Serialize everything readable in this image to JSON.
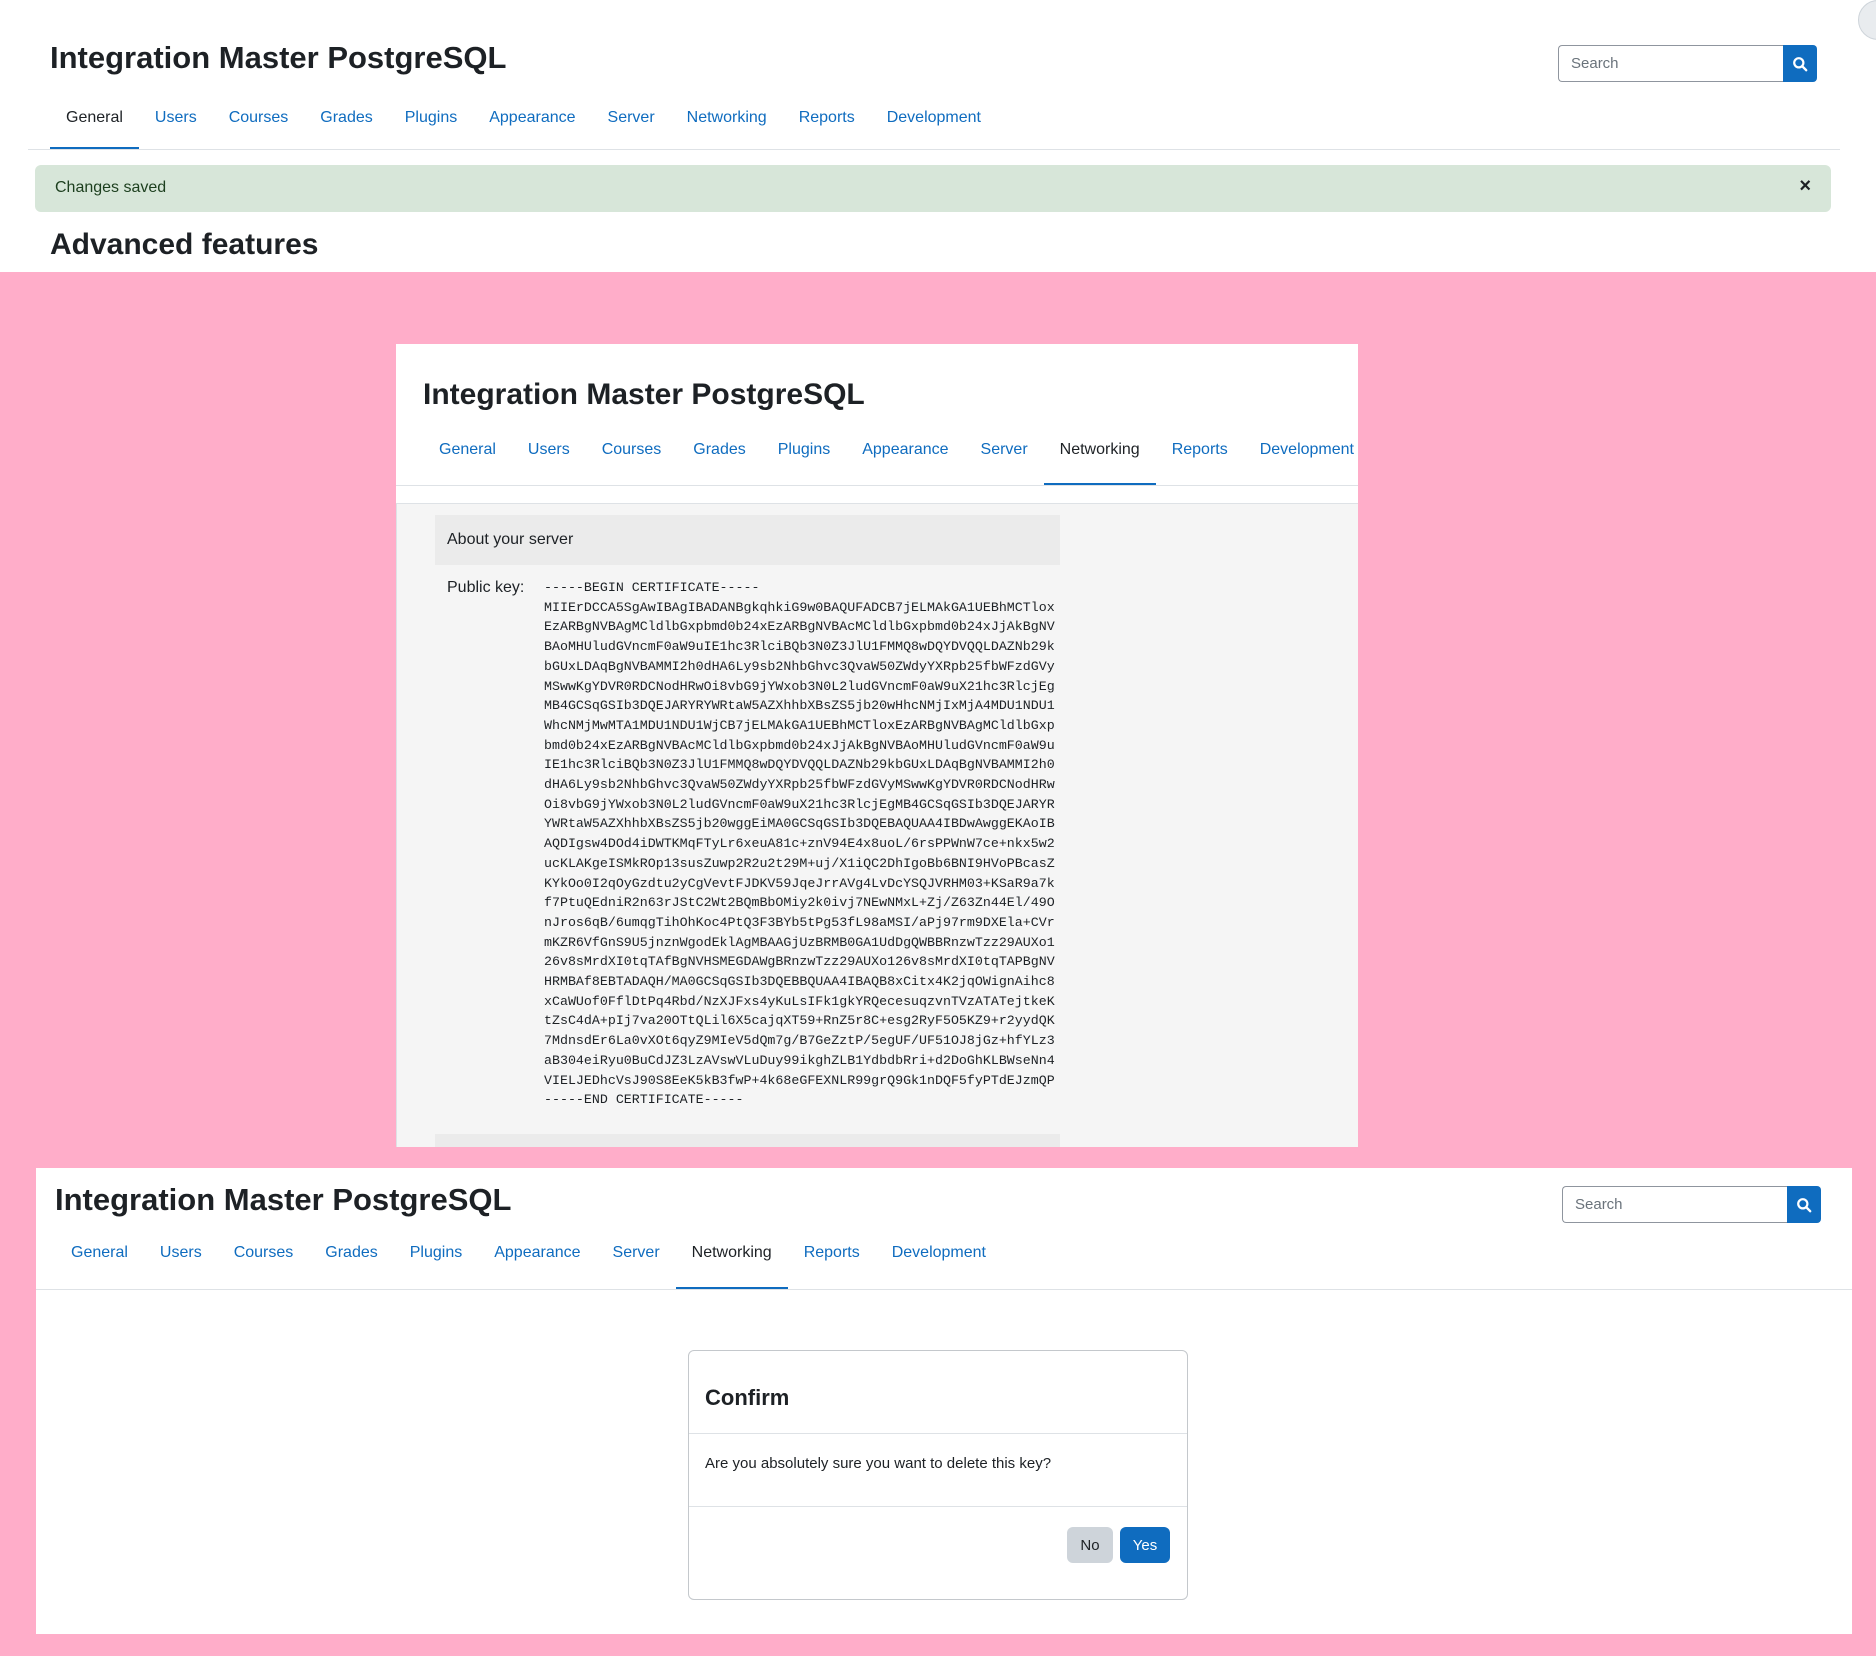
{
  "site_title": "Integration Master PostgreSQL",
  "search": {
    "placeholder": "Search"
  },
  "nav_tabs": [
    "General",
    "Users",
    "Courses",
    "Grades",
    "Plugins",
    "Appearance",
    "Server",
    "Networking",
    "Reports",
    "Development"
  ],
  "panel_general": {
    "active_tab": "General",
    "alert_message": "Changes saved",
    "alert_close": "×",
    "page_heading": "Advanced features"
  },
  "panel_networking": {
    "active_tab": "Networking",
    "section_heading": "About your server",
    "public_key_label": "Public key:",
    "public_key_lines": [
      "-----BEGIN CERTIFICATE-----",
      "MIIErDCCA5SgAwIBAgIBADANBgkqhkiG9w0BAQUFADCB7jELMAkGA1UEBhMCTlox",
      "EzARBgNVBAgMCldlbGxpbmd0b24xEzARBgNVBAcMCldlbGxpbmd0b24xJjAkBgNV",
      "BAoMHUludGVncmF0aW9uIE1hc3RlciBQb3N0Z3JlU1FMMQ8wDQYDVQQLDAZNb29k",
      "bGUxLDAqBgNVBAMMI2h0dHA6Ly9sb2NhbGhvc3QvaW50ZWdyYXRpb25fbWFzdGVy",
      "MSwwKgYDVR0RDCNodHRwOi8vbG9jYWxob3N0L2ludGVncmF0aW9uX21hc3RlcjEg",
      "MB4GCSqGSIb3DQEJARYRYWRtaW5AZXhhbXBsZS5jb20wHhcNMjIxMjA4MDU1NDU1",
      "WhcNMjMwMTA1MDU1NDU1WjCB7jELMAkGA1UEBhMCTloxEzARBgNVBAgMCldlbGxp",
      "bmd0b24xEzARBgNVBAcMCldlbGxpbmd0b24xJjAkBgNVBAoMHUludGVncmF0aW9u",
      "IE1hc3RlciBQb3N0Z3JlU1FMMQ8wDQYDVQQLDAZNb29kbGUxLDAqBgNVBAMMI2h0",
      "dHA6Ly9sb2NhbGhvc3QvaW50ZWdyYXRpb25fbWFzdGVyMSwwKgYDVR0RDCNodHRw",
      "Oi8vbG9jYWxob3N0L2ludGVncmF0aW9uX21hc3RlcjEgMB4GCSqGSIb3DQEJARYR",
      "YWRtaW5AZXhhbXBsZS5jb20wggEiMA0GCSqGSIb3DQEBAQUAA4IBDwAwggEKAoIB",
      "AQDIgsw4DOd4iDWTKMqFTyLr6xeuA81c+znV94E4x8uoL/6rsPPWnW7ce+nkx5w2",
      "ucKLAKgeISMkROp13susZuwp2R2u2t29M+uj/X1iQC2DhIgoBb6BNI9HVoPBcasZ",
      "KYkOo0I2qOyGzdtu2yCgVevtFJDKV59JqeJrrAVg4LvDcYSQJVRHM03+KSaR9a7k",
      "f7PtuQEdniR2n63rJStC2Wt2BQmBbOMiy2k0ivj7NEwNMxL+Zj/Z63Zn44El/49O",
      "nJros6qB/6umqgTihOhKoc4PtQ3F3BYb5tPg53fL98aMSI/aPj97rm9DXEla+CVr",
      "mKZR6VfGnS9U5jnznWgodEklAgMBAAGjUzBRMB0GA1UdDgQWBBRnzwTzz29AUXo1",
      "26v8sMrdXI0tqTAfBgNVHSMEGDAWgBRnzwTzz29AUXo126v8sMrdXI0tqTAPBgNV",
      "HRMBAf8EBTADAQH/MA0GCSqGSIb3DQEBBQUAA4IBAQB8xCitx4K2jqOWignAihc8",
      "xCaWUof0FflDtPq4Rbd/NzXJFxs4yKuLsIFk1gkYRQecesuqzvnTVzATATejtkeK",
      "tZsC4dA+pIj7va20OTtQLil6X5cajqXT59+RnZ5r8C+esg2RyF5O5KZ9+r2yydQK",
      "7MdnsdEr6La0vXOt6qyZ9MIeV5dQm7g/B7GeZztP/5egUF/UF51OJ8jGz+hfYLz3",
      "aB304eiRyu0BuCdJZ3LzAVswVLuDuy99ikghZLB1YdbdbRri+d2DoGhKLBWseNn4",
      "VIELJEDhcVsJ90S8EeK5kB3fwP+4k68eGFEXNLR99grQ9Gk1nDQF5fyPTdEJzmQP",
      "-----END CERTIFICATE-----"
    ]
  },
  "panel_confirm": {
    "active_tab": "Networking",
    "modal_title": "Confirm",
    "modal_body": "Are you absolutely sure you want to delete this key?",
    "no_label": "No",
    "yes_label": "Yes"
  },
  "colors": {
    "brand": "#0f6cbf",
    "background": "#ffadc9",
    "alert_bg": "#d7e6d9",
    "secondary_button": "#ced4da"
  }
}
